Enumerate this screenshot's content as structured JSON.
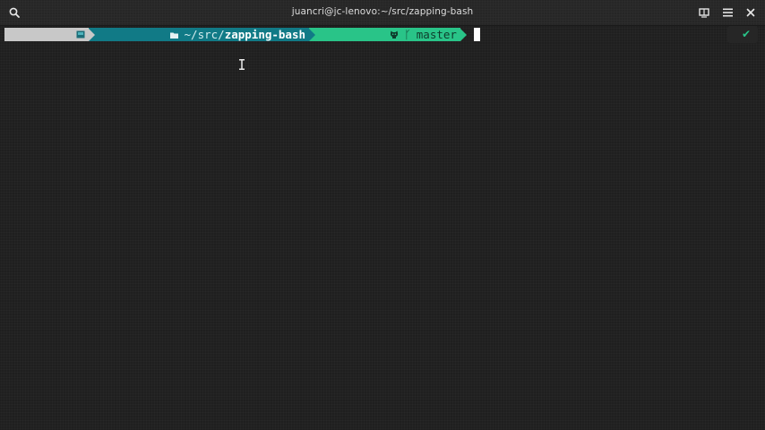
{
  "window": {
    "title": "juancri@jc-lenovo:~/src/zapping-bash"
  },
  "titlebar": {
    "icons": [
      "search-icon",
      "split-view-icon",
      "hamburger-menu-icon",
      "close-icon"
    ]
  },
  "prompt": {
    "os_icon": "terminal-square-icon",
    "folder_icon": "folder-icon",
    "dir_prefix": "~/src/",
    "dir_name": "zapping-bash",
    "git_icon": "github-cat-icon",
    "branch_icon": "git-branch-icon",
    "branch_glyph": "ᚴ",
    "branch": "master"
  },
  "status": {
    "check": "✔"
  },
  "colors": {
    "terminal_bg": "#1f1f1f",
    "dir_segment": "#117a86",
    "git_segment": "#29c488",
    "os_segment": "#c8c8c8",
    "status_ok": "#29c488"
  }
}
